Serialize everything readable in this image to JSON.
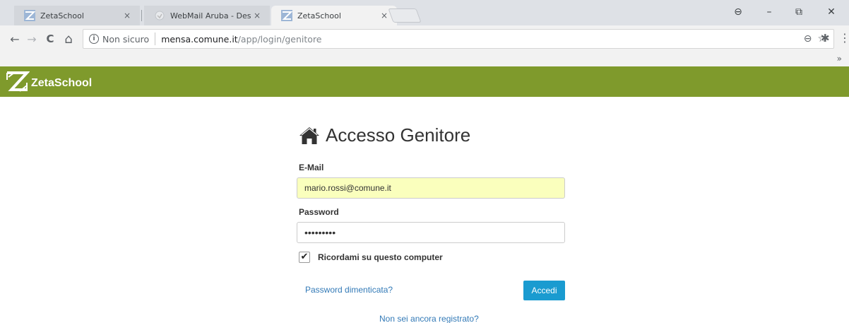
{
  "browser": {
    "tabs": [
      {
        "title": "ZetaSchool",
        "close": "×",
        "icon": "zetaschool-favicon",
        "active": false
      },
      {
        "title": "WebMail Aruba - Deskto",
        "close": "×",
        "icon": "webmail-favicon",
        "active": false
      },
      {
        "title": "ZetaSchool",
        "close": "×",
        "icon": "zetaschool-favicon",
        "active": true
      }
    ],
    "window_controls": {
      "profile": "⊖",
      "minimize": "–",
      "restore": "⧉",
      "close": "✕"
    },
    "nav": {
      "back": "←",
      "forward": "→",
      "reload": "C",
      "home": "⌂"
    },
    "address": {
      "info_icon": "i",
      "security_label": "Non sicuro",
      "host": "mensa.comune.it",
      "path": "/app/login/genitore"
    },
    "omnibox_icons": {
      "zoom": "⊖",
      "star": "☆",
      "extension": "✱"
    },
    "menu": "⋮",
    "bookmarks_more": "»"
  },
  "app": {
    "brand": "ZetaSchool",
    "colors": {
      "header": "#7f9a2c",
      "button": "#1a9bd0",
      "link": "#337ab7",
      "autofill": "#faffbd"
    }
  },
  "login": {
    "title": "Accesso Genitore",
    "title_icon": "home-icon",
    "email_label": "E-Mail",
    "email_value": "mario.rossi@comune.it",
    "password_label": "Password",
    "password_value": "•••••••••",
    "remember_label": "Ricordami su questo computer",
    "remember_checked": "✔",
    "forgot_link": "Password dimenticata?",
    "submit_label": "Accedi",
    "register_link": "Non sei ancora registrato?"
  }
}
